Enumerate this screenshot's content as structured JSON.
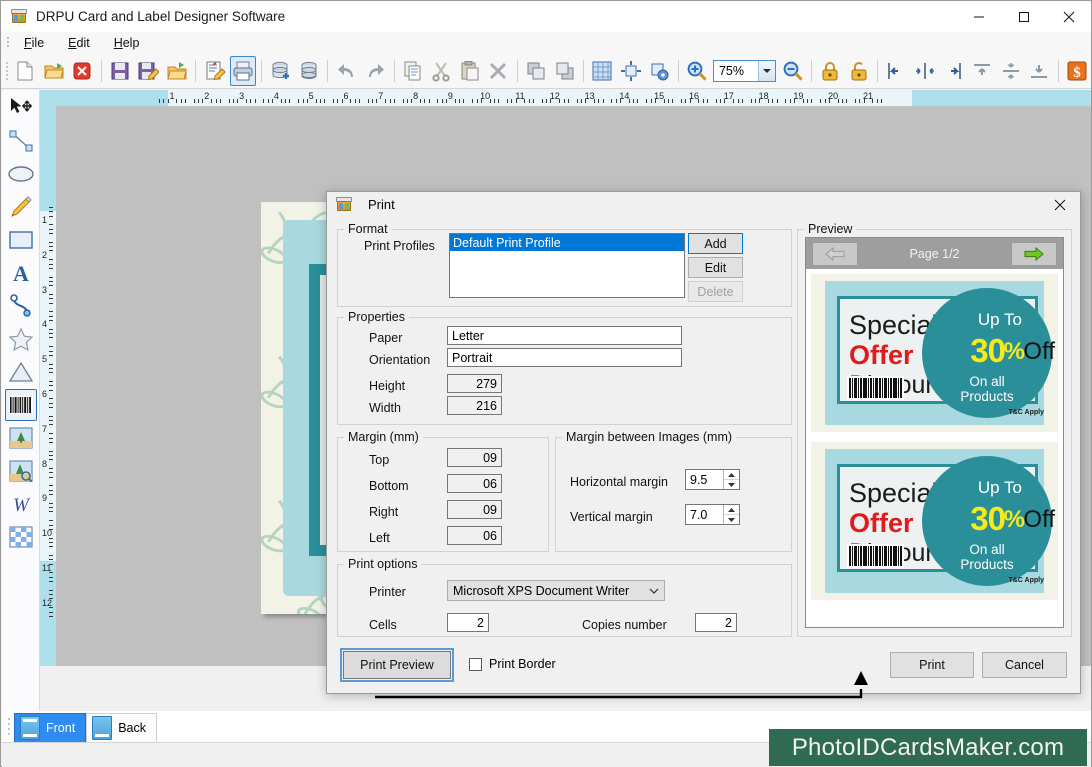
{
  "window": {
    "title": "DRPU Card and Label Designer Software",
    "icon": "app-card-icon",
    "controls": {
      "minimize": "—",
      "maximize": "□",
      "close": "✕"
    }
  },
  "menubar": {
    "items": [
      {
        "label": "File",
        "accel": "F"
      },
      {
        "label": "Edit",
        "accel": "E"
      },
      {
        "label": "Help",
        "accel": "H"
      }
    ]
  },
  "toolbar": {
    "zoom_value": "75%",
    "buttons": [
      {
        "name": "new-document-icon",
        "tooltip": "New"
      },
      {
        "name": "open-folder-icon",
        "tooltip": "Open"
      },
      {
        "name": "close-document-icon",
        "tooltip": "Close"
      },
      {
        "name": "save-icon",
        "tooltip": "Save"
      },
      {
        "name": "save-as-icon",
        "tooltip": "Save As"
      },
      {
        "name": "export-folder-icon",
        "tooltip": "Export"
      },
      {
        "name": "edit-document-icon",
        "tooltip": "Edit"
      },
      {
        "name": "print-icon",
        "tooltip": "Print",
        "selected": true
      },
      {
        "name": "database-add-icon",
        "tooltip": "Add Database"
      },
      {
        "name": "database-icon",
        "tooltip": "Database"
      },
      {
        "name": "undo-icon",
        "tooltip": "Undo"
      },
      {
        "name": "redo-icon",
        "tooltip": "Redo"
      },
      {
        "name": "copy-icon",
        "tooltip": "Copy"
      },
      {
        "name": "cut-icon",
        "tooltip": "Cut"
      },
      {
        "name": "paste-icon",
        "tooltip": "Paste"
      },
      {
        "name": "delete-icon",
        "tooltip": "Delete"
      },
      {
        "name": "bring-forward-icon",
        "tooltip": "Bring Forward"
      },
      {
        "name": "send-backward-icon",
        "tooltip": "Send Backward"
      },
      {
        "name": "grid-icon",
        "tooltip": "Show Grid"
      },
      {
        "name": "fit-object-icon",
        "tooltip": "Fit Object"
      },
      {
        "name": "object-settings-icon",
        "tooltip": "Object Settings"
      },
      {
        "name": "zoom-in-icon",
        "tooltip": "Zoom In"
      },
      {
        "name": "zoom-out-icon",
        "tooltip": "Zoom Out"
      },
      {
        "name": "lock-icon",
        "tooltip": "Lock"
      },
      {
        "name": "unlock-icon",
        "tooltip": "Unlock"
      },
      {
        "name": "align-left-icon",
        "tooltip": "Align Left"
      },
      {
        "name": "align-center-horizontal-icon",
        "tooltip": "Align Center"
      },
      {
        "name": "align-right-icon",
        "tooltip": "Align Right"
      },
      {
        "name": "align-top-icon",
        "tooltip": "Align Top"
      },
      {
        "name": "align-middle-vertical-icon",
        "tooltip": "Align Middle"
      },
      {
        "name": "align-bottom-icon",
        "tooltip": "Align Bottom"
      },
      {
        "name": "currency-icon",
        "tooltip": "Price"
      }
    ]
  },
  "palette": {
    "tools": [
      {
        "name": "select-move-tool",
        "label": "Select"
      },
      {
        "name": "line-tool",
        "label": "Line"
      },
      {
        "name": "ellipse-tool",
        "label": "Ellipse"
      },
      {
        "name": "pencil-tool",
        "label": "Pencil"
      },
      {
        "name": "rectangle-tool",
        "label": "Rectangle"
      },
      {
        "name": "text-tool",
        "label": "Text"
      },
      {
        "name": "curve-tool",
        "label": "Curve"
      },
      {
        "name": "star-tool",
        "label": "Star"
      },
      {
        "name": "triangle-tool",
        "label": "Triangle"
      },
      {
        "name": "barcode-tool",
        "label": "Barcode",
        "selected": true
      },
      {
        "name": "image-tool",
        "label": "Image"
      },
      {
        "name": "image-effects-tool",
        "label": "Image Effects"
      },
      {
        "name": "watermark-tool",
        "label": "Watermark"
      },
      {
        "name": "pattern-tool",
        "label": "Pattern"
      }
    ]
  },
  "rulers": {
    "horizontal_labels": [
      "1",
      "2",
      "3",
      "4",
      "5",
      "6",
      "7",
      "8",
      "9",
      "10",
      "11",
      "12",
      "13",
      "14",
      "15",
      "16",
      "17",
      "18",
      "19",
      "20",
      "21"
    ],
    "vertical_labels": [
      "1",
      "2",
      "3",
      "4",
      "5",
      "6",
      "7",
      "8",
      "9",
      "10",
      "11",
      "12"
    ]
  },
  "sidetabs": {
    "items": [
      {
        "label": "Front",
        "active": true
      },
      {
        "label": "Back",
        "active": false
      }
    ]
  },
  "watermark": {
    "text": "PhotoIDCardsMaker.com",
    "color": "#2f6b53"
  },
  "dialog": {
    "title": "Print",
    "close_label": "✕",
    "format": {
      "legend": "Format",
      "print_profiles_label": "Print Profiles",
      "profiles": [
        "Default Print Profile"
      ],
      "selected_profile": "Default Print Profile",
      "add_label": "Add",
      "edit_label": "Edit",
      "delete_label": "Delete"
    },
    "properties": {
      "legend": "Properties",
      "paper_label": "Paper",
      "paper_value": "Letter",
      "orientation_label": "Orientation",
      "orientation_value": "Portrait",
      "height_label": "Height",
      "height_value": "279",
      "width_label": "Width",
      "width_value": "216"
    },
    "margin": {
      "legend": "Margin (mm)",
      "top_label": "Top",
      "top_value": "09",
      "bottom_label": "Bottom",
      "bottom_value": "06",
      "right_label": "Right",
      "right_value": "09",
      "left_label": "Left",
      "left_value": "06"
    },
    "margin_images": {
      "legend": "Margin between Images (mm)",
      "horizontal_label": "Horizontal margin",
      "horizontal_value": "9.5",
      "vertical_label": "Vertical margin",
      "vertical_value": "7.0"
    },
    "print_options": {
      "legend": "Print options",
      "printer_label": "Printer",
      "printer_value": "Microsoft XPS Document Writer",
      "cells_label": "Cells",
      "cells_value": "2",
      "copies_label": "Copies number",
      "copies_value": "2"
    },
    "footer": {
      "print_preview_label": "Print Preview",
      "print_border_label": "Print Border",
      "print_border_checked": false,
      "print_label": "Print",
      "cancel_label": "Cancel"
    },
    "preview": {
      "legend": "Preview",
      "page_label": "Page 1/2",
      "prev_icon": "arrow-left-icon",
      "next_icon": "arrow-right-icon",
      "cards": [
        {
          "special": "Special",
          "offer": "Offer",
          "discount": "Discount",
          "up_to": "Up To",
          "percent_number": "30",
          "percent_sign": "%",
          "off": "Off",
          "on_all": "On all\nProducts",
          "on_all_line1": "On all",
          "on_all_line2": "Products",
          "terms": "T&C Apply"
        },
        {
          "special": "Special",
          "offer": "Offer",
          "discount": "Discount",
          "up_to": "Up To",
          "percent_number": "30",
          "percent_sign": "%",
          "off": "Off",
          "on_all_line1": "On all",
          "on_all_line2": "Products",
          "terms": "T&C Apply"
        }
      ]
    }
  },
  "colors": {
    "accent_teal": "#2a8f99",
    "card_band": "#a8d9e0",
    "offer_red": "#e01b1b",
    "percent_yellow": "#f6eb19",
    "selection_blue": "#0078d7",
    "watermark_green": "#2f6b53"
  }
}
